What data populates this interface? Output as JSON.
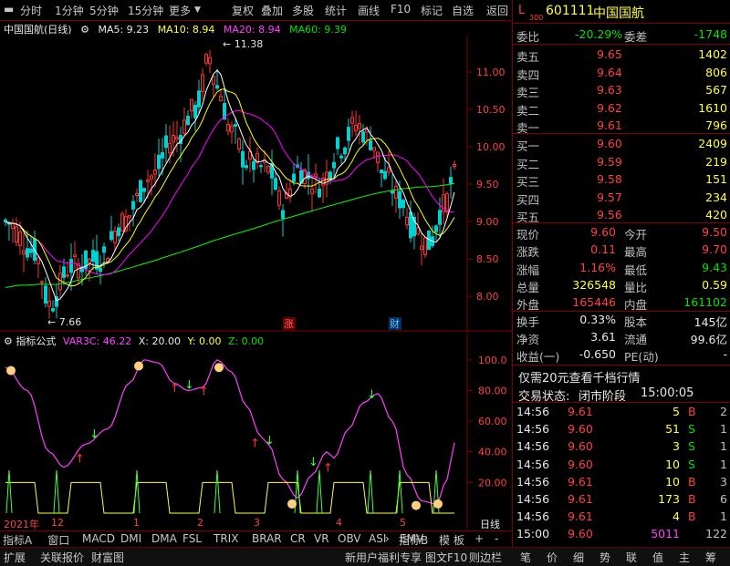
{
  "toolbar": {
    "items": [
      "分时",
      "1分钟",
      "5分钟",
      "15分钟",
      "更多",
      "复权",
      "叠加",
      "多股",
      "统计",
      "画线",
      "F10",
      "标记",
      "自选",
      "返回"
    ],
    "more_icon": "chevron-down-icon",
    "add_icon": "minus-icon"
  },
  "kline": {
    "title": "中国国航(日线)",
    "ma5": "MA5: 9.23",
    "ma10": "MA10: 8.94",
    "ma20": "MA20: 8.94",
    "ma60": "MA60: 9.39",
    "high_label": "11.38",
    "low_label": "7.66",
    "yaxis": [
      "11.00",
      "10.50",
      "10.00",
      "9.50",
      "9.00",
      "8.50",
      "8.00"
    ],
    "marker_zhang": "涨",
    "marker_cai": "财",
    "colors": {
      "up": "#ff3030",
      "down": "#00d0d0",
      "ma5": "#ffffff",
      "ma10": "#ffff00",
      "ma20": "#ff00ff",
      "ma60": "#00ff00"
    }
  },
  "chart_data": {
    "type": "candlestick",
    "ylim": [
      7.6,
      11.5
    ],
    "ma_lines": [
      "MA5",
      "MA10",
      "MA20",
      "MA60"
    ],
    "high": 11.38,
    "low": 7.66
  },
  "indicator": {
    "title": "指标公式",
    "var3c": "VAR3C: 46.22",
    "x": "X: 20.00",
    "y": "Y: 0.00",
    "z": "Z: 0.00",
    "yaxis": [
      "100.0",
      "80.00",
      "60.00",
      "40.00",
      "20.00"
    ]
  },
  "timeaxis": {
    "labels": [
      "2021年",
      "12",
      "1",
      "2",
      "3",
      "4",
      "5"
    ],
    "period": "日线"
  },
  "indicator_tabs": [
    "指标A",
    "窗口",
    "MACD",
    "DMI",
    "DMA",
    "FSL",
    "TRIX",
    "BRAR",
    "CR",
    "VR",
    "OBV",
    "ASI",
    "EMV"
  ],
  "indicator_tabs_more": [
    "指标B",
    "模 板",
    "+",
    "-"
  ],
  "statusbar": {
    "left": [
      "扩展",
      "关联报价",
      "财富图"
    ],
    "right": [
      "新用户福利专享",
      "图文F10",
      "则边栏"
    ],
    "panel_tabs": [
      "笔",
      "价",
      "细",
      "势",
      "联",
      "值",
      "主",
      "筹"
    ]
  },
  "quote": {
    "market_tag": "L",
    "market_sub": "300",
    "code": "601111",
    "name": "中国国航",
    "weibi_label": "委比",
    "weibi": "-20.29%",
    "weicha_label": "委差",
    "weicha": "-1748",
    "asks": [
      {
        "label": "卖五",
        "price": "9.65",
        "vol": "1402"
      },
      {
        "label": "卖四",
        "price": "9.64",
        "vol": "806"
      },
      {
        "label": "卖三",
        "price": "9.63",
        "vol": "567"
      },
      {
        "label": "卖二",
        "price": "9.62",
        "vol": "1610"
      },
      {
        "label": "卖一",
        "price": "9.61",
        "vol": "796"
      }
    ],
    "bids": [
      {
        "label": "买一",
        "price": "9.60",
        "vol": "2409"
      },
      {
        "label": "买二",
        "price": "9.59",
        "vol": "219"
      },
      {
        "label": "买三",
        "price": "9.58",
        "vol": "151"
      },
      {
        "label": "买四",
        "price": "9.57",
        "vol": "234"
      },
      {
        "label": "买五",
        "price": "9.56",
        "vol": "420"
      }
    ],
    "stats": [
      {
        "l1": "现价",
        "v1": "9.60",
        "c1": "red",
        "l2": "今开",
        "v2": "9.50",
        "c2": "red"
      },
      {
        "l1": "涨跌",
        "v1": "0.11",
        "c1": "red",
        "l2": "最高",
        "v2": "9.70",
        "c2": "red"
      },
      {
        "l1": "涨幅",
        "v1": "1.16%",
        "c1": "red",
        "l2": "最低",
        "v2": "9.43",
        "c2": "green"
      },
      {
        "l1": "总量",
        "v1": "326548",
        "c1": "yellow",
        "l2": "量比",
        "v2": "0.59",
        "c2": "yellow"
      },
      {
        "l1": "外盘",
        "v1": "165446",
        "c1": "red",
        "l2": "内盘",
        "v2": "161102",
        "c2": "green"
      }
    ],
    "stats2": [
      {
        "l1": "换手",
        "v1": "0.33%",
        "l2": "股本",
        "v2": "145亿"
      },
      {
        "l1": "净资",
        "v1": "3.61",
        "l2": "流通",
        "v2": "99.6亿"
      },
      {
        "l1": "收益(一)",
        "v1": "-0.650",
        "l2": "PE(动)",
        "v2": "-"
      }
    ],
    "promo": "仅需20元查看千档行情",
    "trade_status_label": "交易状态:",
    "trade_status": "闭市阶段",
    "trade_time": "15:00:05",
    "ticks": [
      {
        "t": "14:56",
        "p": "9.61",
        "v": "5",
        "bs": "B",
        "n": "2"
      },
      {
        "t": "14:56",
        "p": "9.60",
        "v": "51",
        "bs": "S",
        "n": "1"
      },
      {
        "t": "14:56",
        "p": "9.60",
        "v": "3",
        "bs": "S",
        "n": "1"
      },
      {
        "t": "14:56",
        "p": "9.60",
        "v": "10",
        "bs": "S",
        "n": "1"
      },
      {
        "t": "14:56",
        "p": "9.61",
        "v": "10",
        "bs": "B",
        "n": "3"
      },
      {
        "t": "14:56",
        "p": "9.61",
        "v": "173",
        "bs": "B",
        "n": "6"
      },
      {
        "t": "14:56",
        "p": "9.61",
        "v": "4",
        "bs": "B",
        "n": "1"
      },
      {
        "t": "15:00",
        "p": "9.60",
        "v": "5011",
        "bs": "",
        "n": "122"
      }
    ]
  }
}
